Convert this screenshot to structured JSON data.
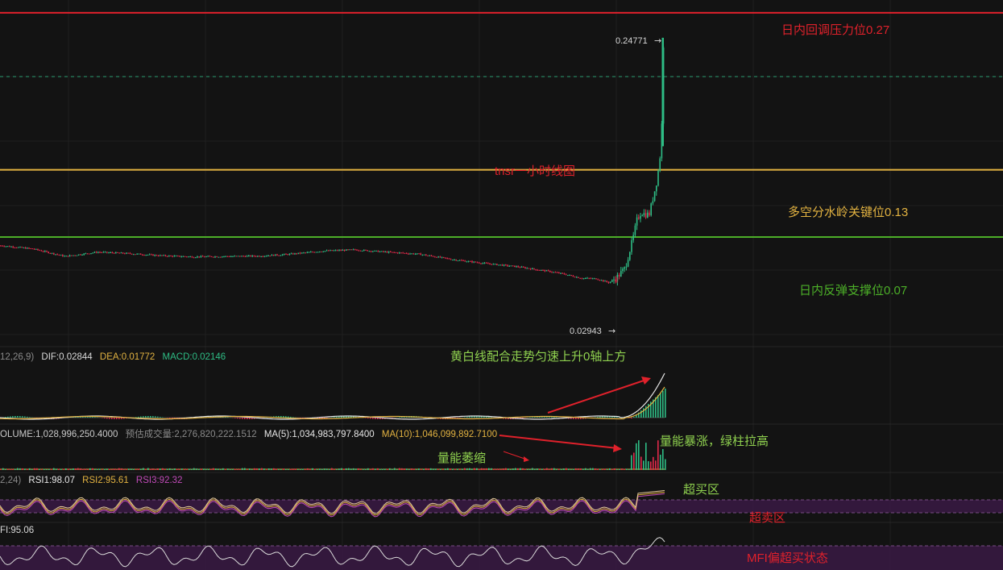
{
  "colors": {
    "background": "#131313",
    "grid": "#1f1f1f",
    "up": "#2ebd85",
    "down": "#e0294a",
    "red_level": "#e0212b",
    "yellow_level": "#e3b341",
    "green_level": "#4caf28",
    "dashed_price": "#2ebd85",
    "annotation_green": "#8fd14f",
    "annotation_red": "#e0212b",
    "annotation_yellow": "#e3b341",
    "overbought_band": "#3a1a44",
    "rsi_line": "#e3c99a",
    "mfi_line": "#d9d9d9"
  },
  "main": {
    "price_high_label": "0.24771",
    "price_low_label": "0.02943",
    "title_annotation": "tnsr一小时线图",
    "levels": [
      {
        "label": "日内回调压力位0.27",
        "price": 0.27,
        "color": "red"
      },
      {
        "label": "多空分水岭关键位0.13",
        "price": 0.13,
        "color": "yellow"
      },
      {
        "label": "日内反弹支撑位0.07",
        "price": 0.07,
        "color": "green"
      }
    ]
  },
  "macd": {
    "params": "12,26,9)",
    "dif": "DIF:0.02844",
    "dea": "DEA:0.01772",
    "macd": "MACD:0.02146",
    "annotation": "黄白线配合走势匀速上升0轴上方"
  },
  "volume": {
    "volume": "OLUME:1,028,996,250.4000",
    "forecast": "预估成交量:2,276,820,222.1512",
    "ma5": "MA(5):1,034,983,797.8400",
    "ma10": "MA(10):1,046,099,892.7100",
    "annotation_shrink": "量能萎缩",
    "annotation_surge": "量能暴涨，绿柱拉高"
  },
  "rsi": {
    "params": "2,24)",
    "rsi1": "RSI1:98.07",
    "rsi2": "RSI2:95.61",
    "rsi3": "RSI3:92.32",
    "overbought_label": "超买区",
    "oversold_label": "超卖区"
  },
  "mfi": {
    "value": "FI:95.06",
    "annotation": "MFI偏超买状态"
  },
  "chart_data": {
    "type": "line",
    "title": "tnsr一小时线图",
    "series": [
      {
        "name": "",
        "x": [
          0,
          40,
          80,
          120,
          160,
          200,
          240,
          280,
          320,
          360,
          400,
          440,
          480,
          520,
          560,
          600,
          640,
          680,
          700,
          720,
          740,
          755,
          765,
          775,
          785,
          790,
          795,
          800,
          805,
          810,
          815,
          820,
          823
        ],
        "values": [
          0.0624,
          0.0595,
          0.0528,
          0.0566,
          0.0553,
          0.0534,
          0.0524,
          0.0528,
          0.0531,
          0.0548,
          0.0576,
          0.0587,
          0.0566,
          0.0548,
          0.0501,
          0.0466,
          0.0437,
          0.0395,
          0.0369,
          0.0334,
          0.0328,
          0.0294,
          0.034,
          0.0422,
          0.0691,
          0.0856,
          0.0922,
          0.0902,
          0.0902,
          0.1055,
          0.122,
          0.151,
          0.2477
        ]
      }
    ],
    "ylim": [
      0.0,
      0.3
    ],
    "levels": [
      0.27,
      0.13,
      0.07
    ],
    "annotations": [
      "0.24771",
      "0.02943"
    ]
  }
}
